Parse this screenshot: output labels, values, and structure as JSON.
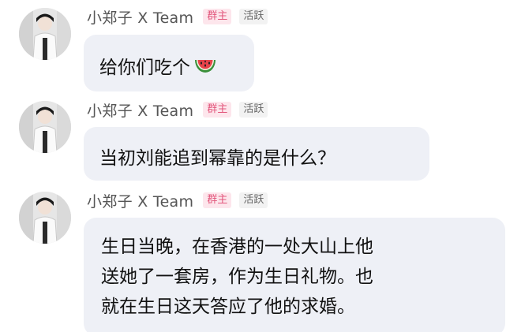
{
  "messages": [
    {
      "sender": "小郑子 X Team",
      "role_badge": "群主",
      "activity_badge": "活跃",
      "text": "给你们吃个",
      "emoji": "watermelon-icon"
    },
    {
      "sender": "小郑子 X Team",
      "role_badge": "群主",
      "activity_badge": "活跃",
      "text": "当初刘能追到幂靠的是什么？"
    },
    {
      "sender": "小郑子 X Team",
      "role_badge": "群主",
      "activity_badge": "活跃",
      "lines": [
        "生日当晚，在香港的一处大山上他",
        "送她了一套房，作为生日礼物。也",
        "就在生日这天答应了他的求婚。"
      ]
    }
  ],
  "colors": {
    "bubble": "#eef0f6",
    "owner_badge_text": "#e2557b",
    "owner_badge_bg": "#fde6ec",
    "active_badge_bg": "#f2f2f2"
  }
}
